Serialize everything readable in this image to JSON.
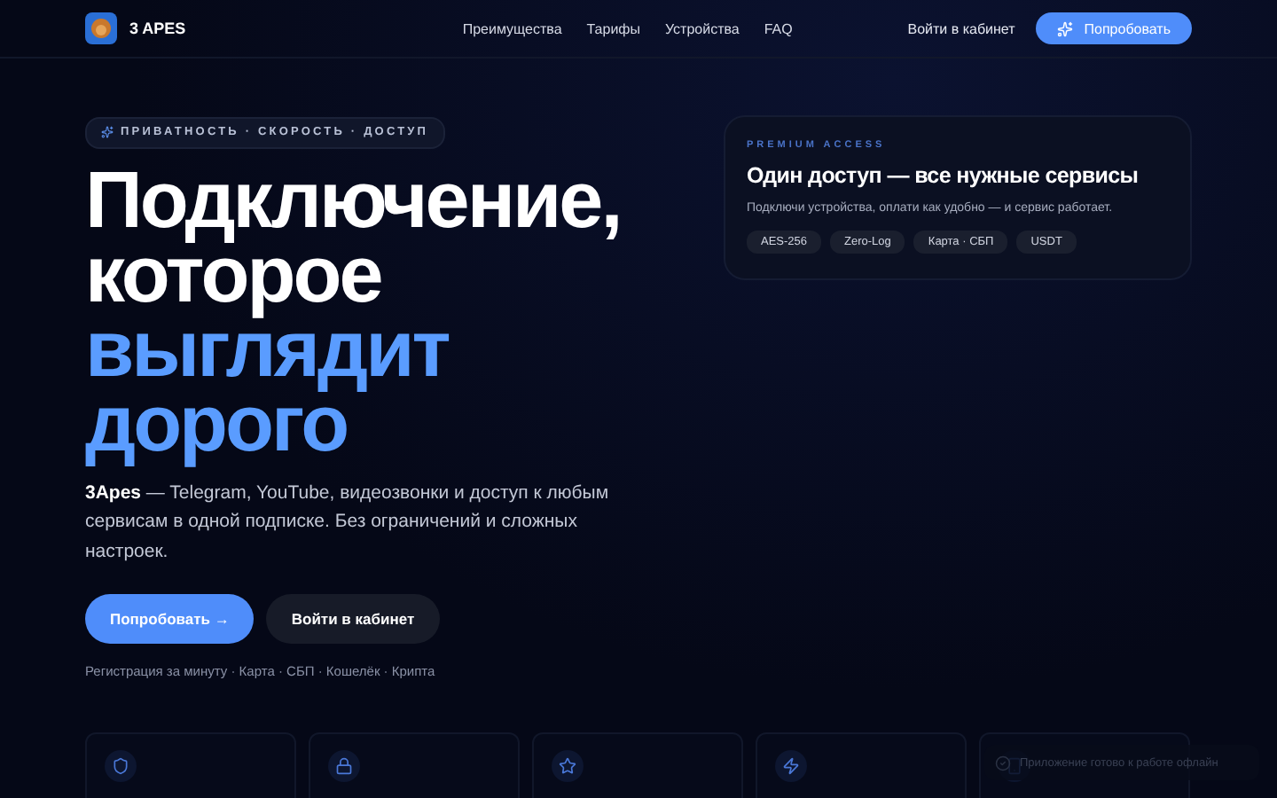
{
  "header": {
    "brand": "3 APES",
    "nav": [
      {
        "label": "Преимущества"
      },
      {
        "label": "Тарифы"
      },
      {
        "label": "Устройства"
      },
      {
        "label": "FAQ"
      }
    ],
    "login": "Войти в кабинет",
    "cta": "Попробовать"
  },
  "hero": {
    "badge": "ПРИВАТНОСТЬ · СКОРОСТЬ · ДОСТУП",
    "title_lines": [
      {
        "text": "Подключение,",
        "accent": false
      },
      {
        "text": "которое",
        "accent": false
      },
      {
        "text": "выглядит",
        "accent": true
      },
      {
        "text": "дорого",
        "accent": true
      }
    ],
    "lead": "**3Apes** — Telegram, YouTube, видеозвонки и доступ к любым сервисам в одной подписке. Без ограничений и сложных настроек.",
    "primary_button": "Попробовать →",
    "secondary_button": "Войти в кабинет",
    "note": "Регистрация за минуту · Карта · СБП · Кошелёк · Крипта"
  },
  "card": {
    "eyebrow": "PREMIUM ACCESS",
    "title": "Один доступ — все нужные сервисы",
    "text": "Подключи устройства, оплати как удобно — и сервис работает.",
    "tags": [
      "AES-256",
      "Zero-Log",
      "Карта · СБП",
      "USDT"
    ]
  },
  "features": [
    {
      "kind": "shield"
    },
    {
      "kind": "lock"
    },
    {
      "kind": "star"
    },
    {
      "kind": "bolt"
    },
    {
      "kind": "phone"
    }
  ],
  "toast": {
    "text": "Приложение готово к работе офлайн"
  }
}
